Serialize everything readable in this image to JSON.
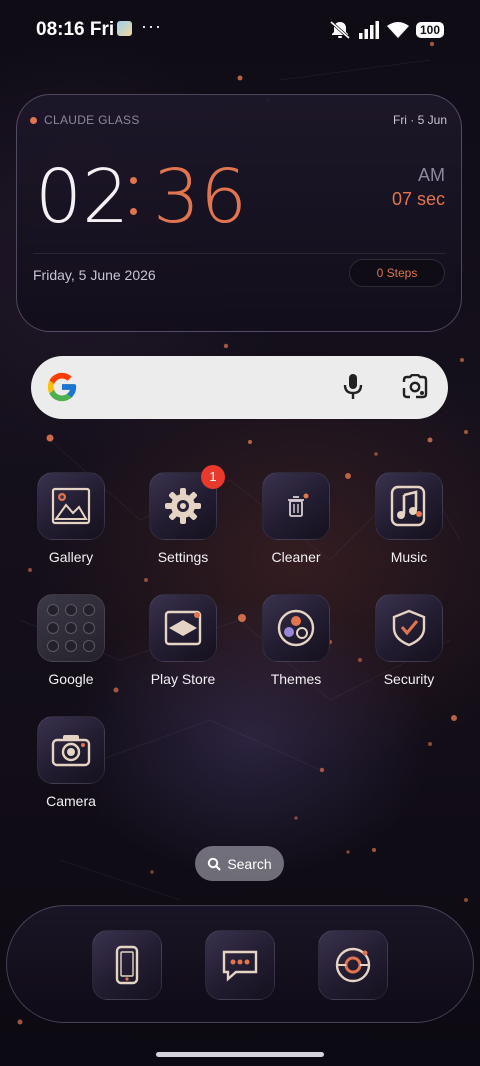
{
  "status_bar": {
    "time": "08:16 Fri",
    "more": "···",
    "battery": "100",
    "icons": [
      "app-notification-icon",
      "mute-icon",
      "signal-icon",
      "wifi-icon",
      "battery-icon"
    ]
  },
  "clock_widget": {
    "brand": "CLAUDE GLASS",
    "date_short": "Fri · 5 Jun",
    "hour": "02",
    "minute": "36",
    "ampm": "AM",
    "seconds": "07 sec",
    "date_long": "Friday, 5 June 2026",
    "steps": "0 Steps"
  },
  "search_bar": {
    "icons": [
      "google-g-icon",
      "microphone-icon",
      "google-lens-icon"
    ]
  },
  "apps": [
    {
      "label": "Gallery",
      "icon": "gallery-icon"
    },
    {
      "label": "Settings",
      "icon": "gear-icon",
      "badge": "1"
    },
    {
      "label": "Cleaner",
      "icon": "trash-icon"
    },
    {
      "label": "Music",
      "icon": "music-icon"
    },
    {
      "label": "Google",
      "icon": "google-folder-icon"
    },
    {
      "label": "Play Store",
      "icon": "play-store-icon"
    },
    {
      "label": "Themes",
      "icon": "themes-icon"
    },
    {
      "label": "Security",
      "icon": "shield-check-icon"
    },
    {
      "label": "Camera",
      "icon": "camera-icon"
    }
  ],
  "drawer_search": {
    "label": "Search"
  },
  "dock": [
    {
      "icon": "phone-icon"
    },
    {
      "icon": "messages-icon"
    },
    {
      "icon": "browser-icon"
    }
  ],
  "colors": {
    "accent": "#e07550",
    "badge": "#e8392c",
    "search_bg": "#ececec"
  }
}
